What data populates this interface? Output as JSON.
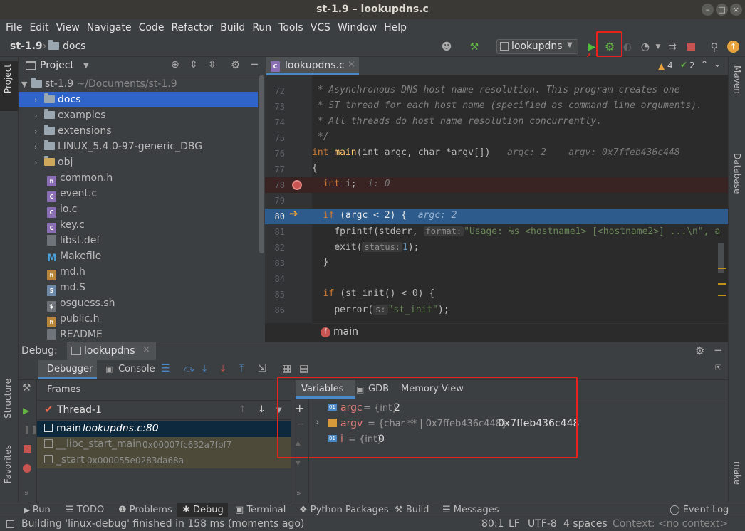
{
  "window": {
    "title": "st-1.9 – lookupdns.c"
  },
  "menu": [
    "File",
    "Edit",
    "View",
    "Navigate",
    "Code",
    "Refactor",
    "Build",
    "Run",
    "Tools",
    "VCS",
    "Window",
    "Help"
  ],
  "breadcrumb": {
    "project": "st-1.9",
    "folder": "docs"
  },
  "toolbar": {
    "run_config": "lookupdns"
  },
  "project_panel": {
    "title": "Project",
    "root": "st-1.9",
    "root_path": "~/Documents/st-1.9",
    "items": [
      {
        "label": "docs",
        "kind": "folder"
      },
      {
        "label": "examples",
        "kind": "folder"
      },
      {
        "label": "extensions",
        "kind": "folder"
      },
      {
        "label": "LINUX_5.4.0-97-generic_DBG",
        "kind": "folder"
      },
      {
        "label": "obj",
        "kind": "folder"
      },
      {
        "label": "common.h",
        "kind": "h"
      },
      {
        "label": "event.c",
        "kind": "c"
      },
      {
        "label": "io.c",
        "kind": "c"
      },
      {
        "label": "key.c",
        "kind": "c"
      },
      {
        "label": "libst.def",
        "kind": "def"
      },
      {
        "label": "Makefile",
        "kind": "make"
      },
      {
        "label": "md.h",
        "kind": "h"
      },
      {
        "label": "md.S",
        "kind": "s"
      },
      {
        "label": "osguess.sh",
        "kind": "sh"
      },
      {
        "label": "public.h",
        "kind": "h"
      },
      {
        "label": "README",
        "kind": "txt"
      }
    ]
  },
  "left_strip": {
    "project": "Project",
    "structure": "Structure",
    "favorites": "Favorites"
  },
  "right_strip": {
    "maven": "Maven",
    "database": "Database",
    "make": "make"
  },
  "editor": {
    "tab": "lookupdns.c",
    "warnings": "4",
    "checks": "2",
    "line_numbers": [
      "72",
      "73",
      "74",
      "75",
      "76",
      "77",
      "78",
      "79",
      "80",
      "81",
      "82",
      "83",
      "84",
      "85",
      "86"
    ],
    "lines": {
      "l72": " * Asynchronous DNS host name resolution. This program creates one",
      "l73": " * ST thread for each host name (specified as command line arguments).",
      "l74": " * All threads do host name resolution concurrently.",
      "l75": " */",
      "l76_kw": "int",
      "l76_fn": "main",
      "l76_rest": "(int argc, char *argv[])",
      "l76_hint1": "argc: 2",
      "l76_hint2": "argv: 0x7ffeb436c448",
      "l77": "{",
      "l78_kw": "int",
      "l78_rest": " i;",
      "l78_hint": "i: 0",
      "l80_kw": "if",
      "l80_rest": " (argc < 2) {",
      "l80_hint": "argc: 2",
      "l81_a": "fprintf(stderr,",
      "l81_hint": "format:",
      "l81_str": "\"Usage: %s <hostname1> [<hostname2>] ...\\n\", a",
      "l82_a": "exit(",
      "l82_hint": "status:",
      "l82_num": "1",
      "l82_b": ");",
      "l83": "}",
      "l85_kw": "if",
      "l85_rest": " (st_init() < 0) {",
      "l86_a": "perror(",
      "l86_hint": "s:",
      "l86_str": "\"st_init\"",
      "l86_b": ");"
    },
    "function_crumb": "main"
  },
  "debug": {
    "label": "Debug:",
    "session": "lookupdns",
    "tabs": {
      "debugger": "Debugger",
      "console": "Console"
    },
    "frames_title": "Frames",
    "thread": "Thread-1",
    "frames": [
      {
        "fn": "main",
        "loc": "lookupdns.c:80"
      },
      {
        "fn": "__libc_start_main",
        "loc": "0x00007fc632a7fbf7"
      },
      {
        "fn": "_start",
        "loc": "0x000055e0283da68a"
      }
    ],
    "var_tabs": [
      "Variables",
      "GDB",
      "Memory View"
    ],
    "variables": [
      {
        "name": "argc",
        "type": "= {int}",
        "value": "2"
      },
      {
        "name": "argv",
        "type": "= {char ** | 0x7ffeb436c448}",
        "value": "0x7ffeb436c448"
      },
      {
        "name": "i",
        "type": "= {int}",
        "value": "0"
      }
    ]
  },
  "bottom_tabs": [
    "Run",
    "TODO",
    "Problems",
    "Debug",
    "Terminal",
    "Python Packages",
    "Build",
    "Messages"
  ],
  "event_log": "Event Log",
  "status": {
    "message": "Building 'linux-debug' finished in 158 ms (moments ago)",
    "position": "80:1",
    "line_sep": "LF",
    "encoding": "UTF-8",
    "indent": "4 spaces",
    "context": "Context: <no context>"
  },
  "colors": {
    "accent_red": "#e8211c",
    "selection_blue": "#2f65ca",
    "exec_line": "#2d5b8c",
    "breakpoint_line": "#3a2323"
  }
}
